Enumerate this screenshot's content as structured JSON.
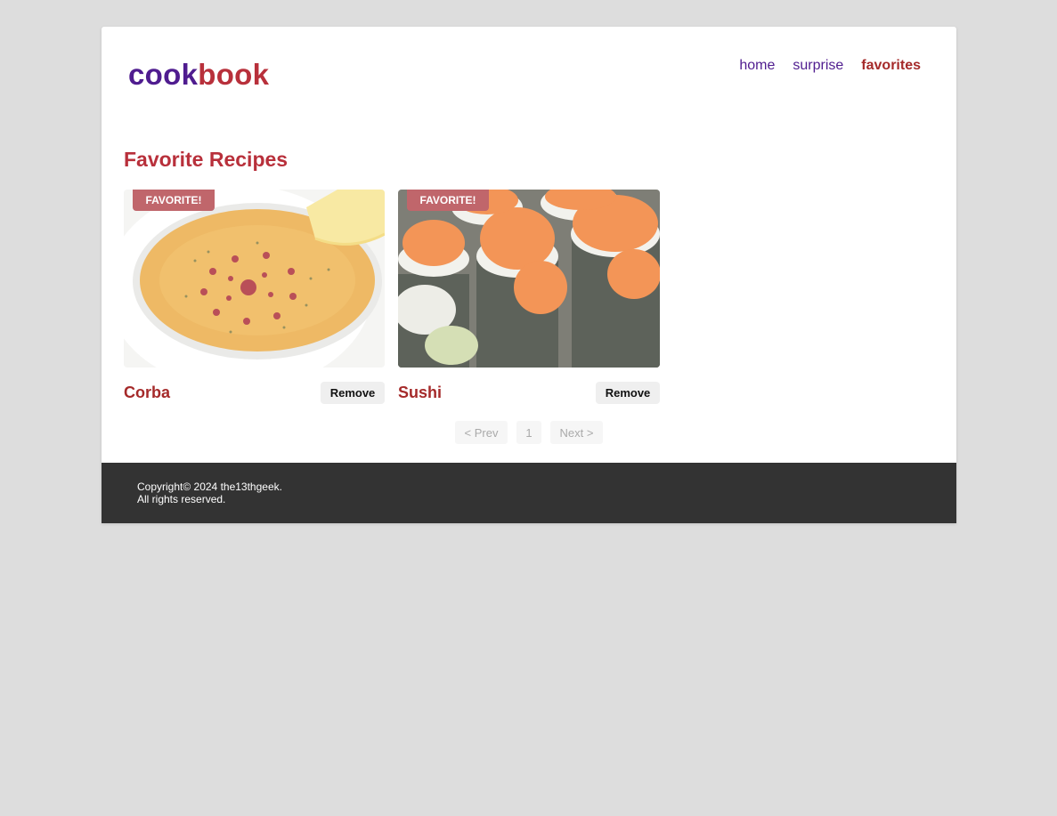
{
  "header": {
    "logo_part1": "cook",
    "logo_part2": "book",
    "nav": [
      {
        "label": "home",
        "active": false
      },
      {
        "label": "surprise",
        "active": false
      },
      {
        "label": "favorites",
        "active": true
      }
    ]
  },
  "main": {
    "title": "Favorite Recipes",
    "recipes": [
      {
        "name": "Corba",
        "badge": "FAVORITE!",
        "action": "Remove",
        "image": "lentil soup in white bowl with lemon wedge"
      },
      {
        "name": "Sushi",
        "badge": "FAVORITE!",
        "action": "Remove",
        "image": "sushi rolls topped with orange fish roe"
      }
    ],
    "pagination": {
      "prev": "< Prev",
      "page": "1",
      "next": "Next >"
    }
  },
  "footer": {
    "line1": "Copyright© 2024 the13thgeek.",
    "line2": "All rights reserved."
  },
  "colors": {
    "brand_purple": "#4f1c8f",
    "brand_red": "#b8303b",
    "badge": "#c0666b",
    "footer_bg": "#333333",
    "page_bg": "#dddddd"
  }
}
